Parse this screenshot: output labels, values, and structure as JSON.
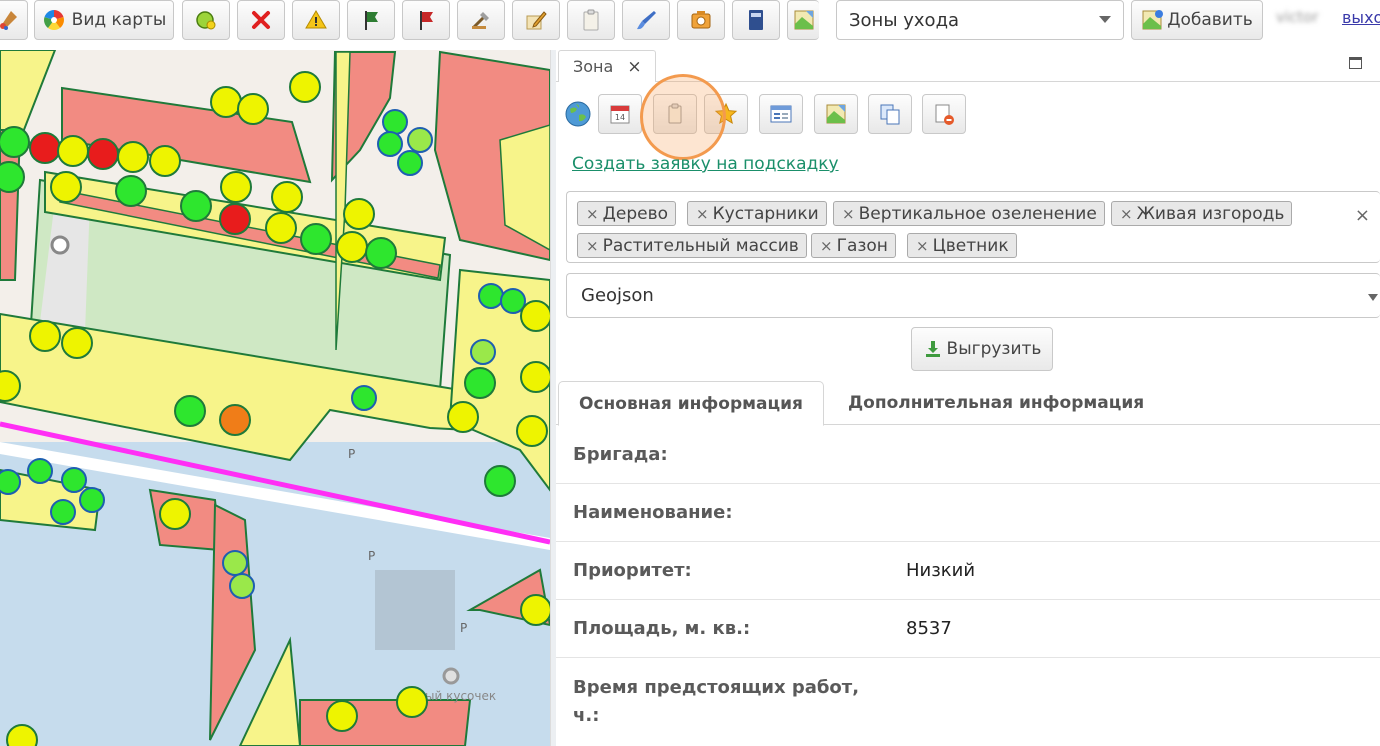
{
  "toolbar": {
    "map_view_label": "Вид карты",
    "zone_select_value": "Зоны ухода",
    "add_label": "Добавить",
    "user_name": "victor",
    "logout_label": "выхо"
  },
  "panel": {
    "tab_title": "Зона",
    "tab_close": "×",
    "create_request_link": "Создать заявку на подскадку",
    "tags": [
      "Дерево",
      "Кустарники",
      "Вертикальное озеленение",
      "Живая изгородь",
      "Растительный массив",
      "Газон",
      "Цветник"
    ],
    "tag_remove_glyph": "×",
    "tags_clear_glyph": "×",
    "format_select_value": "Geojson",
    "export_label": "Выгрузить",
    "tabs": {
      "main": "Основная информация",
      "extra": "Дополнительная информация"
    },
    "fields": [
      {
        "label": "Бригада:",
        "value": ""
      },
      {
        "label": "Наименование:",
        "value": ""
      },
      {
        "label": "Приоритет:",
        "value": "Низкий"
      },
      {
        "label": "Площадь, м. кв.:",
        "value": "8537"
      },
      {
        "label": "Время предстоящих работ,",
        "label2": "ч.:",
        "value": ""
      }
    ]
  },
  "map": {
    "labels": [
      "P",
      "P",
      "P",
      "ый кусочек"
    ],
    "colors": {
      "building": "#f28b82",
      "zone_yellow": "#f7f48a",
      "zone_green": "#cfe8c4",
      "water_blue": "#bcd6ea",
      "border": "#1f7a3a",
      "tree_green": "#2ee62e",
      "tree_yellow": "#eef400",
      "tree_red": "#e81c1c",
      "tree_orange": "#f07d18",
      "road_magenta": "#ff2ef5"
    }
  },
  "icons": {
    "toolbar": [
      "brush-icon",
      "color-wheel-icon",
      "circle-add-icon",
      "delete-x-icon",
      "warning-icon",
      "flag-green-icon",
      "flag-red-icon",
      "tool-cut-icon",
      "pen-edit-icon",
      "clipboard-icon",
      "brush-blue-icon",
      "photo-camera-icon",
      "book-icon",
      "map-image-icon",
      "map-add-icon"
    ],
    "panel": [
      "globe-icon",
      "calendar-icon",
      "clipboard-icon",
      "star-icon",
      "list-form-icon",
      "map-image-icon",
      "copy-icon",
      "delete-doc-icon",
      "download-icon"
    ]
  }
}
